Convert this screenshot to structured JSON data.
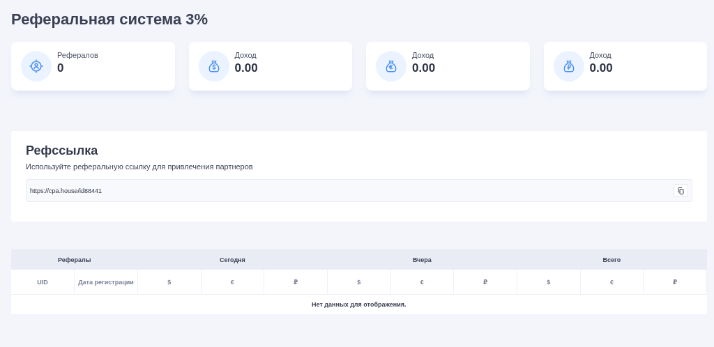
{
  "title": "Реферальная система 3%",
  "stats": [
    {
      "kind": "referrals",
      "label": "Рефералов",
      "value": "0"
    },
    {
      "kind": "dollar",
      "label": "Доход",
      "value": "0.00"
    },
    {
      "kind": "euro",
      "label": "Доход",
      "value": "0.00"
    },
    {
      "kind": "ruble",
      "label": "Доход",
      "value": "0.00"
    }
  ],
  "reflink": {
    "heading": "Рефссылка",
    "description": "Используйте реферальную ссылку для привлечения партнеров",
    "value": "https://cpa.house/id88441"
  },
  "table": {
    "groups": [
      "Рефералы",
      "Сегодня",
      "Вчера",
      "Всего"
    ],
    "columns": [
      "UID",
      "Дата регистрации",
      "$",
      "€",
      "₽",
      "$",
      "€",
      "₽",
      "$",
      "€",
      "₽"
    ],
    "empty": "Нет данных для отображения."
  }
}
